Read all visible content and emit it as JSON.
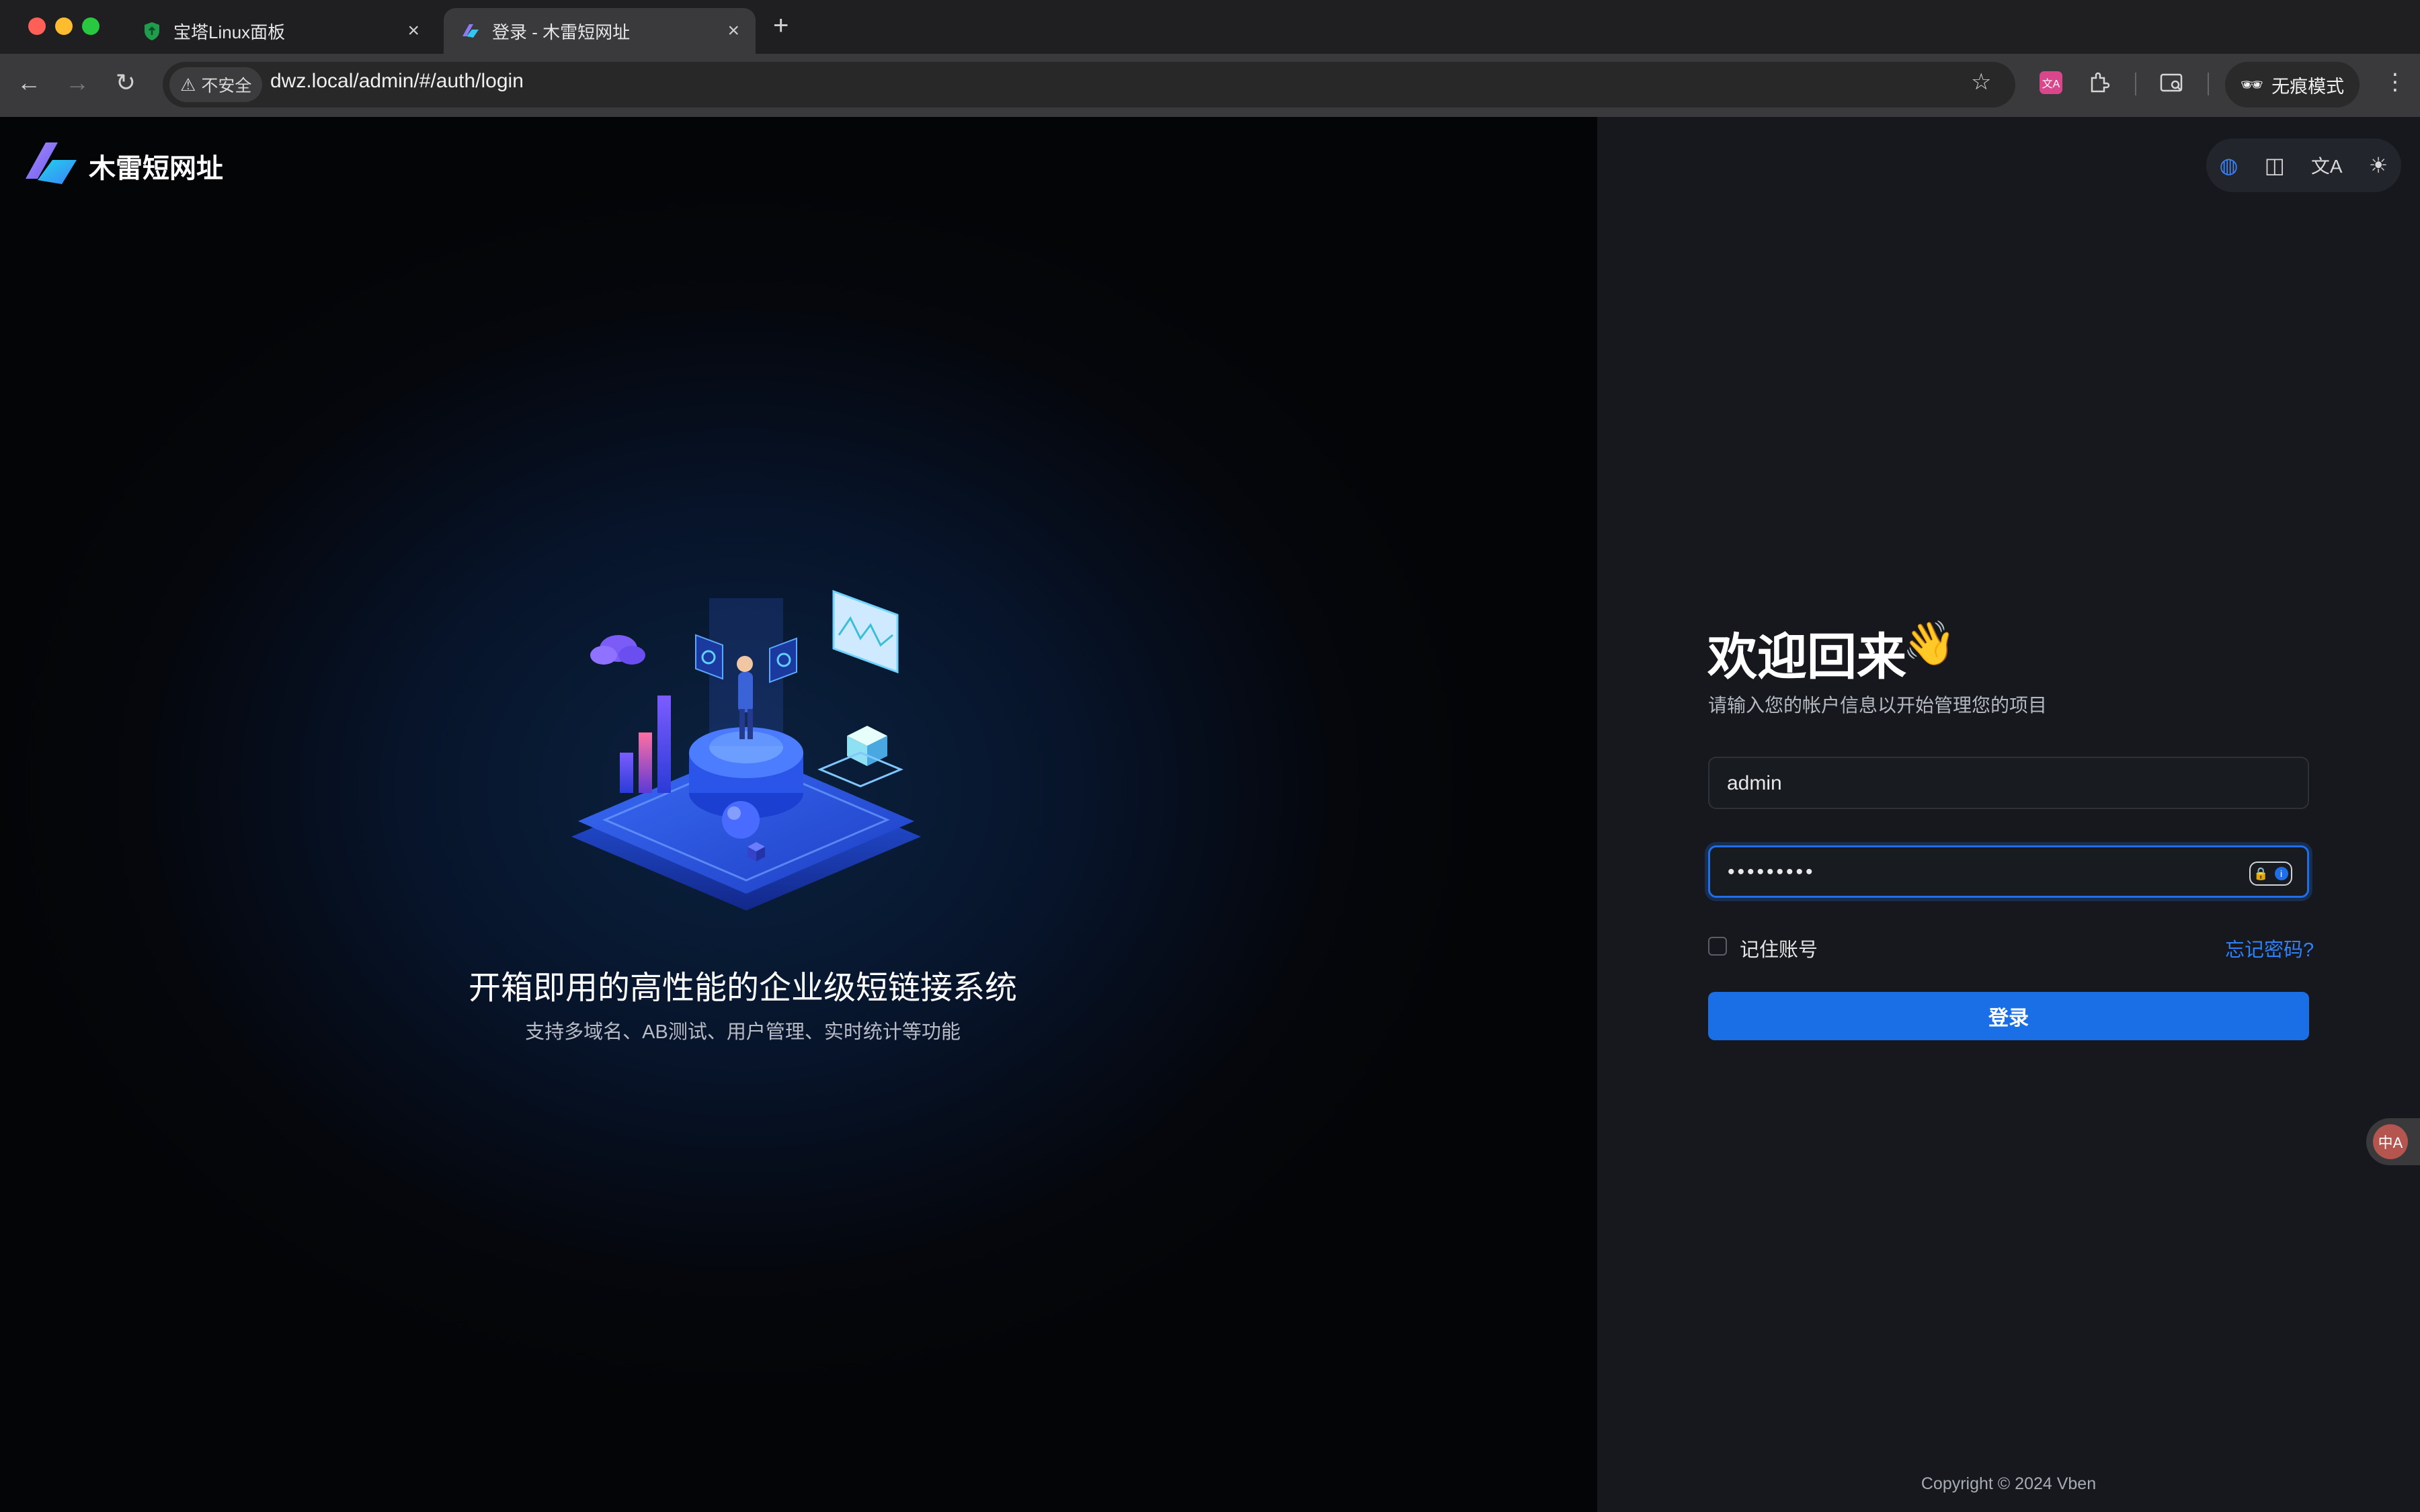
{
  "browser": {
    "tabs": [
      {
        "title": "宝塔Linux面板",
        "active": false
      },
      {
        "title": "登录 - 木雷短网址",
        "active": true
      }
    ],
    "new_tab_glyph": "+",
    "close_glyph": "×",
    "security_label": "不安全",
    "url": "dwz.local/admin/#/auth/login",
    "incognito_label": "无痕模式",
    "icons": [
      "back-icon",
      "forward-icon",
      "reload-icon",
      "star-icon",
      "translate-ext-icon",
      "extensions-icon",
      "tab-search-icon",
      "incognito-icon",
      "menu-icon"
    ]
  },
  "brand": {
    "name": "木雷短网址",
    "accent": "#1a6fe6"
  },
  "hero": {
    "slogan": "开箱即用的高性能的企业级短链接系统",
    "subtitle": "支持多域名、AB测试、用户管理、实时统计等功能"
  },
  "toolbar_icons": [
    "palette-icon",
    "layout-icon",
    "language-icon",
    "theme-sun-icon"
  ],
  "login": {
    "title": "欢迎回来",
    "title_emoji": "👋",
    "subtitle": "请输入您的帐户信息以开始管理您的项目",
    "username_value": "admin",
    "password_value": "•••••••••",
    "remember_label": "记住账号",
    "forgot_label": "忘记密码?",
    "submit_label": "登录"
  },
  "translate_fab_glyph": "中A",
  "footer": {
    "copyright": "Copyright © 2024 Vben"
  }
}
